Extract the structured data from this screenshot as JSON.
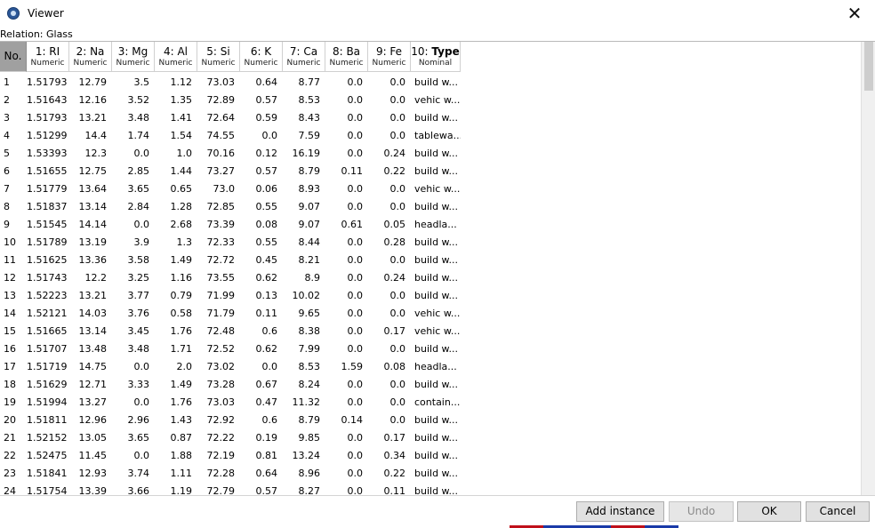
{
  "window": {
    "title": "Viewer",
    "close_glyph": "✕"
  },
  "relation": "Relation: Glass",
  "columns": [
    {
      "id": "no",
      "name": "No.",
      "type": ""
    },
    {
      "id": "ri",
      "name": "1: RI",
      "type": "Numeric"
    },
    {
      "id": "na",
      "name": "2: Na",
      "type": "Numeric"
    },
    {
      "id": "mg",
      "name": "3: Mg",
      "type": "Numeric"
    },
    {
      "id": "al",
      "name": "4: Al",
      "type": "Numeric"
    },
    {
      "id": "si",
      "name": "5: Si",
      "type": "Numeric"
    },
    {
      "id": "k",
      "name": "6: K",
      "type": "Numeric"
    },
    {
      "id": "ca",
      "name": "7: Ca",
      "type": "Numeric"
    },
    {
      "id": "ba",
      "name": "8: Ba",
      "type": "Numeric"
    },
    {
      "id": "fe",
      "name": "9: Fe",
      "type": "Numeric"
    },
    {
      "id": "type",
      "name_prefix": "10: ",
      "name_bold": "Type",
      "type": "Nominal"
    }
  ],
  "rows": [
    [
      "1",
      "1.51793",
      "12.79",
      "3.5",
      "1.12",
      "73.03",
      "0.64",
      "8.77",
      "0.0",
      "0.0",
      "build w..."
    ],
    [
      "2",
      "1.51643",
      "12.16",
      "3.52",
      "1.35",
      "72.89",
      "0.57",
      "8.53",
      "0.0",
      "0.0",
      "vehic w..."
    ],
    [
      "3",
      "1.51793",
      "13.21",
      "3.48",
      "1.41",
      "72.64",
      "0.59",
      "8.43",
      "0.0",
      "0.0",
      "build w..."
    ],
    [
      "4",
      "1.51299",
      "14.4",
      "1.74",
      "1.54",
      "74.55",
      "0.0",
      "7.59",
      "0.0",
      "0.0",
      "tablewa..."
    ],
    [
      "5",
      "1.53393",
      "12.3",
      "0.0",
      "1.0",
      "70.16",
      "0.12",
      "16.19",
      "0.0",
      "0.24",
      "build w..."
    ],
    [
      "6",
      "1.51655",
      "12.75",
      "2.85",
      "1.44",
      "73.27",
      "0.57",
      "8.79",
      "0.11",
      "0.22",
      "build w..."
    ],
    [
      "7",
      "1.51779",
      "13.64",
      "3.65",
      "0.65",
      "73.0",
      "0.06",
      "8.93",
      "0.0",
      "0.0",
      "vehic w..."
    ],
    [
      "8",
      "1.51837",
      "13.14",
      "2.84",
      "1.28",
      "72.85",
      "0.55",
      "9.07",
      "0.0",
      "0.0",
      "build w..."
    ],
    [
      "9",
      "1.51545",
      "14.14",
      "0.0",
      "2.68",
      "73.39",
      "0.08",
      "9.07",
      "0.61",
      "0.05",
      "headla..."
    ],
    [
      "10",
      "1.51789",
      "13.19",
      "3.9",
      "1.3",
      "72.33",
      "0.55",
      "8.44",
      "0.0",
      "0.28",
      "build w..."
    ],
    [
      "11",
      "1.51625",
      "13.36",
      "3.58",
      "1.49",
      "72.72",
      "0.45",
      "8.21",
      "0.0",
      "0.0",
      "build w..."
    ],
    [
      "12",
      "1.51743",
      "12.2",
      "3.25",
      "1.16",
      "73.55",
      "0.62",
      "8.9",
      "0.0",
      "0.24",
      "build w..."
    ],
    [
      "13",
      "1.52223",
      "13.21",
      "3.77",
      "0.79",
      "71.99",
      "0.13",
      "10.02",
      "0.0",
      "0.0",
      "build w..."
    ],
    [
      "14",
      "1.52121",
      "14.03",
      "3.76",
      "0.58",
      "71.79",
      "0.11",
      "9.65",
      "0.0",
      "0.0",
      "vehic w..."
    ],
    [
      "15",
      "1.51665",
      "13.14",
      "3.45",
      "1.76",
      "72.48",
      "0.6",
      "8.38",
      "0.0",
      "0.17",
      "vehic w..."
    ],
    [
      "16",
      "1.51707",
      "13.48",
      "3.48",
      "1.71",
      "72.52",
      "0.62",
      "7.99",
      "0.0",
      "0.0",
      "build w..."
    ],
    [
      "17",
      "1.51719",
      "14.75",
      "0.0",
      "2.0",
      "73.02",
      "0.0",
      "8.53",
      "1.59",
      "0.08",
      "headla..."
    ],
    [
      "18",
      "1.51629",
      "12.71",
      "3.33",
      "1.49",
      "73.28",
      "0.67",
      "8.24",
      "0.0",
      "0.0",
      "build w..."
    ],
    [
      "19",
      "1.51994",
      "13.27",
      "0.0",
      "1.76",
      "73.03",
      "0.47",
      "11.32",
      "0.0",
      "0.0",
      "contain..."
    ],
    [
      "20",
      "1.51811",
      "12.96",
      "2.96",
      "1.43",
      "72.92",
      "0.6",
      "8.79",
      "0.14",
      "0.0",
      "build w..."
    ],
    [
      "21",
      "1.52152",
      "13.05",
      "3.65",
      "0.87",
      "72.22",
      "0.19",
      "9.85",
      "0.0",
      "0.17",
      "build w..."
    ],
    [
      "22",
      "1.52475",
      "11.45",
      "0.0",
      "1.88",
      "72.19",
      "0.81",
      "13.24",
      "0.0",
      "0.34",
      "build w..."
    ],
    [
      "23",
      "1.51841",
      "12.93",
      "3.74",
      "1.11",
      "72.28",
      "0.64",
      "8.96",
      "0.0",
      "0.22",
      "build w..."
    ],
    [
      "24",
      "1.51754",
      "13.39",
      "3.66",
      "1.19",
      "72.79",
      "0.57",
      "8.27",
      "0.0",
      "0.11",
      "build w..."
    ]
  ],
  "buttons": {
    "add_instance": "Add instance",
    "undo": "Undo",
    "ok": "OK",
    "cancel": "Cancel"
  },
  "colors": {
    "header_no_bg": "#a0a0a0",
    "button_bg": "#e1e1e1",
    "taskbar_red": "#c0101a",
    "taskbar_blue": "#1a3aa8"
  }
}
